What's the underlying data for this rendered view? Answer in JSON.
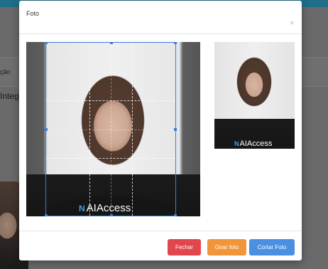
{
  "background": {
    "label1": "ção",
    "label2": "Integ"
  },
  "modal": {
    "title": "Foto",
    "close_symbol": "×",
    "watermark": "AIAccess",
    "watermark_mark": "N",
    "buttons": {
      "close": "Fechar",
      "rotate": "Girar foto",
      "crop": "Cortar Foto"
    }
  },
  "colors": {
    "primary": "#4a8fe2",
    "danger": "#e0474c",
    "warning": "#f0953a",
    "crop_border": "#3c7be0"
  }
}
